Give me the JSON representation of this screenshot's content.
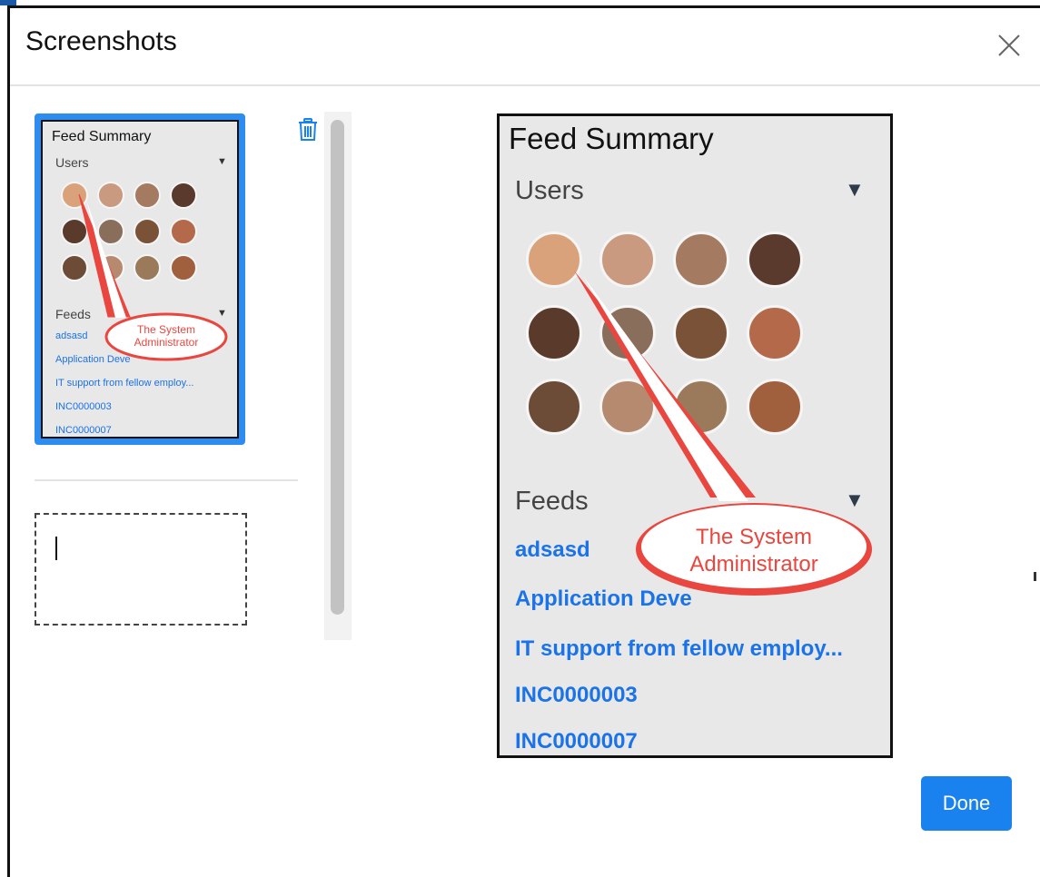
{
  "dialog": {
    "title": "Screenshots",
    "close_icon": "close-icon",
    "done_label": "Done",
    "accent": "#1a82ee"
  },
  "thumbnail": {
    "title": "Feed Summary",
    "users_label": "Users",
    "feeds_label": "Feeds",
    "links": [
      "adsasd",
      "Application Deve",
      "IT support from fellow employ...",
      "INC0000003",
      "INC0000007"
    ],
    "callout_line1": "The System",
    "callout_line2": "Administrator"
  },
  "delete_icon": "trash-icon",
  "preview": {
    "title": "Feed Summary",
    "users_label": "Users",
    "feeds_label": "Feeds",
    "links": [
      "adsasd",
      "Application Deve",
      "IT support from fellow employ...",
      "INC0000003",
      "INC0000007"
    ],
    "callout_line1": "The System",
    "callout_line2": "Administrator",
    "callout_color": "#e8463e"
  },
  "avatar_colors": [
    "#d9a27a",
    "#c99a7f",
    "#a47a60",
    "#5a3a2c",
    "#5a3a2a",
    "#8a6e5c",
    "#7a5238",
    "#b46a4a",
    "#6c4c36",
    "#b58a6e",
    "#9a7a5a",
    "#a0603e"
  ]
}
